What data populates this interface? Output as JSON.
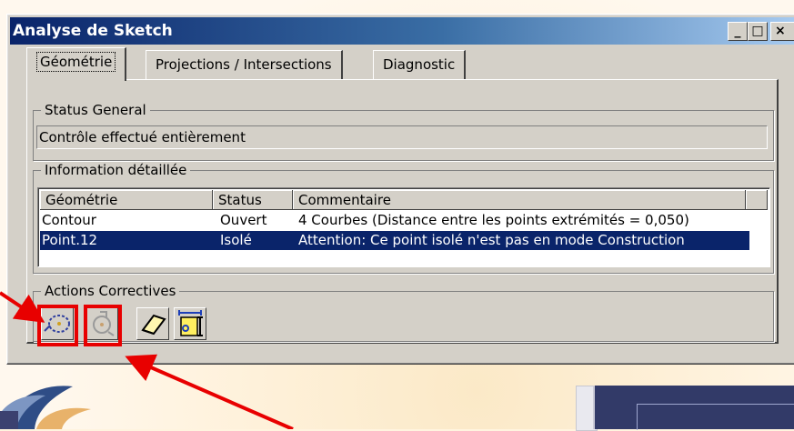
{
  "window": {
    "title": "Analyse de Sketch",
    "controls": [
      "minimize-icon",
      "maximize-icon",
      "close-icon"
    ]
  },
  "tabs": [
    {
      "label": "Géométrie",
      "active": true
    },
    {
      "label": "Projections / Intersections",
      "active": false
    },
    {
      "label": "Diagnostic",
      "active": false
    }
  ],
  "status_general": {
    "legend": "Status General",
    "value": "Contrôle effectué entièrement"
  },
  "info": {
    "legend": "Information détaillée",
    "columns": [
      "Géométrie",
      "Status",
      "Commentaire"
    ],
    "rows": [
      {
        "geometry": "Contour",
        "status": "Ouvert",
        "comment": "4 Courbes (Distance entre les points extrémités = 0,050)"
      },
      {
        "geometry": "Point.12",
        "status": "Isolé",
        "comment": "Attention: Ce point isolé n'est pas en mode Construction"
      }
    ],
    "selected_row": 1
  },
  "actions": {
    "legend": "Actions Correctives",
    "buttons": [
      "close-curve-icon",
      "point-construction-icon",
      "eraser-icon",
      "dimension-constraint-icon"
    ],
    "highlighted": [
      0,
      1
    ]
  },
  "colors": {
    "title_start": "#0a246a",
    "title_end": "#a6caf0",
    "selection": "#0a246a",
    "highlight": "#e80000",
    "dialog": "#d4d0c8"
  }
}
